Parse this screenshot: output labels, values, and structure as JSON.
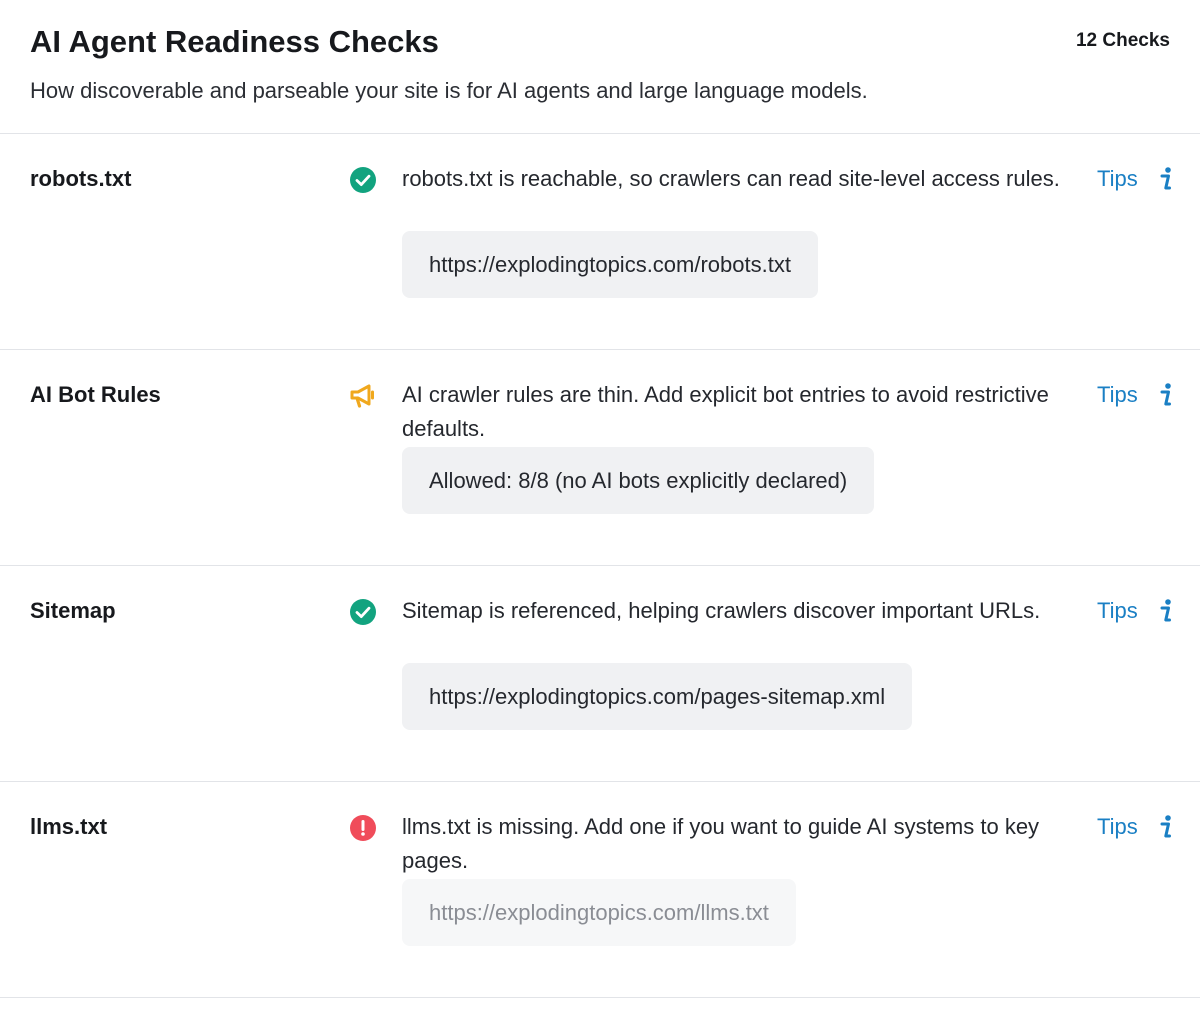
{
  "header": {
    "title": "AI Agent Readiness Checks",
    "count": "12 Checks",
    "subtitle": "How discoverable and parseable your site is for AI agents and large language models."
  },
  "colors": {
    "pass": "#12a37f",
    "warning": "#f0a81d",
    "fail": "#f04c5a",
    "link": "#1a7fc4"
  },
  "checks": [
    {
      "name": "robots.txt",
      "status": "pass",
      "status_icon": "check-circle-icon",
      "description": "robots.txt is reachable, so crawlers can read site-level access rules.",
      "value": "https://explodingtopics.com/robots.txt",
      "tips_label": "Tips",
      "info_icon": "info-icon"
    },
    {
      "name": "AI Bot Rules",
      "status": "warning",
      "status_icon": "megaphone-icon",
      "description": "AI crawler rules are thin. Add explicit bot entries to avoid restrictive defaults.",
      "value": "Allowed: 8/8 (no AI bots explicitly declared)",
      "tips_label": "Tips",
      "info_icon": "info-icon"
    },
    {
      "name": "Sitemap",
      "status": "pass",
      "status_icon": "check-circle-icon",
      "description": "Sitemap is referenced, helping crawlers discover important URLs.",
      "value": "https://explodingtopics.com/pages-sitemap.xml",
      "tips_label": "Tips",
      "info_icon": "info-icon"
    },
    {
      "name": "llms.txt",
      "status": "fail",
      "status_icon": "exclamation-circle-icon",
      "description": "llms.txt is missing. Add one if you want to guide AI systems to key pages.",
      "value": "https://explodingtopics.com/llms.txt",
      "tips_label": "Tips",
      "info_icon": "info-icon"
    }
  ]
}
